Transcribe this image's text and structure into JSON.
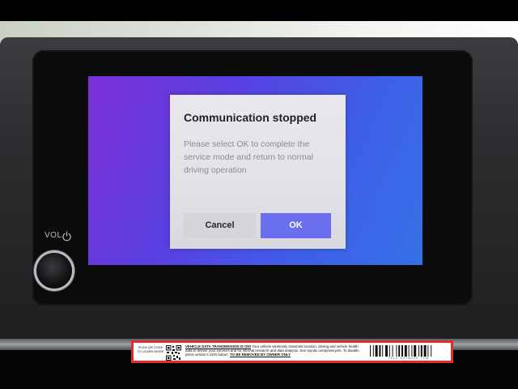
{
  "dialog": {
    "title": "Communication stopped",
    "message": "Please select OK to complete the service mode and return to normal driving operation",
    "cancel_label": "Cancel",
    "ok_label": "OK"
  },
  "controls": {
    "volume_label": "VOL",
    "power_icon": "power-icon",
    "knob_icon": "volume-knob"
  },
  "sticker": {
    "scan_text": "SCAN QR CODE TO LEARN MORE",
    "headline": "VEHICLE DATA TRANSMISSION IS ON!",
    "body": " Your vehicle wirelessly transmits location, driving and vehicle health data to deliver your services and for internal research and data analysis. See toyota.com/privacyvts. To disable, press vehicle's SOS button. ",
    "removal_note": "TO BE REMOVED BY OWNER ONLY",
    "barcode_caption": "TELE DATAUSE TCM",
    "qr_icon": "qr-code",
    "barcode_icon": "barcode"
  },
  "colors": {
    "screen_gradient_start": "#7c2fd6",
    "screen_gradient_end": "#3470e6",
    "ok_button": "#6a6ff0",
    "sticker_border": "#e32b2b"
  }
}
